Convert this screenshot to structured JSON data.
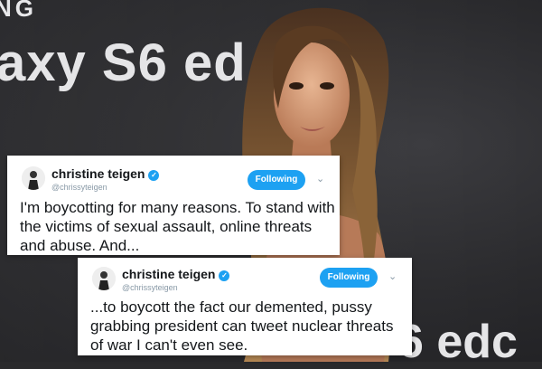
{
  "background": {
    "brand_top": "NG",
    "brand_main": "axy S6 ed",
    "brand_bottom": "6 edc"
  },
  "tweets": [
    {
      "name": "christine teigen",
      "handle": "@chrissyteigen",
      "follow_label": "Following",
      "text": "I'm boycotting for many reasons. To stand with the victims of sexual assault, online threats and abuse. And..."
    },
    {
      "name": "christine teigen",
      "handle": "@chrissyteigen",
      "follow_label": "Following",
      "text": "...to boycott the fact our demented, pussy grabbing president can tweet nuclear threats of war I can't even see."
    }
  ],
  "colors": {
    "accent": "#1da1f2",
    "card_bg": "#ffffff",
    "text": "#14171a",
    "muted": "#8899a6"
  }
}
